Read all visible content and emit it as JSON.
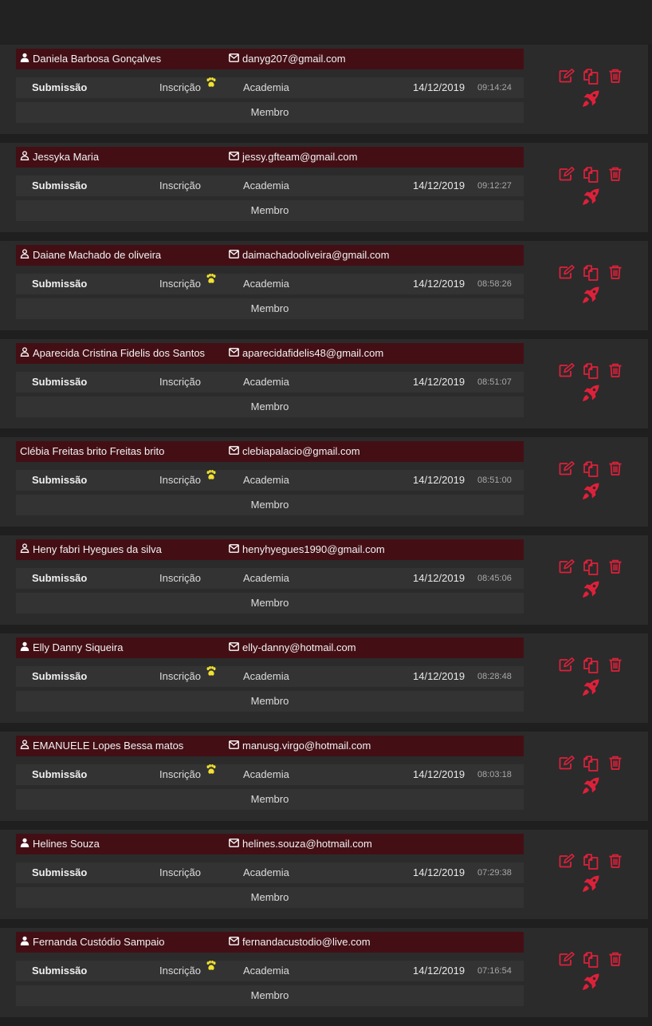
{
  "colors": {
    "accent": "#e0203a",
    "name_bar": "#430f15",
    "row_bg": "#333333",
    "card_bg": "#2b2b2b",
    "paw": "#f2e230"
  },
  "labels": {
    "submission": "Submissão",
    "inscription": "Inscrição",
    "academy": "Academia",
    "role": "Membro"
  },
  "records": [
    {
      "name": "Daniela Barbosa Gonçalves",
      "email": "danyg207@gmail.com",
      "date": "14/12/2019",
      "time": "09:14:24",
      "user_icon": "user-filled-icon",
      "paw": true
    },
    {
      "name": "Jessyka Maria",
      "email": "jessy.gfteam@gmail.com",
      "date": "14/12/2019",
      "time": "09:12:27",
      "user_icon": "user-outline-icon",
      "paw": false
    },
    {
      "name": "Daiane Machado de oliveira",
      "email": "daimachadooliveira@gmail.com",
      "date": "14/12/2019",
      "time": "08:58:26",
      "user_icon": "user-outline-icon",
      "paw": true
    },
    {
      "name": "Aparecida Cristina Fidelis dos Santos",
      "email": "aparecidafidelis48@gmail.com",
      "date": "14/12/2019",
      "time": "08:51:07",
      "user_icon": "user-outline-icon",
      "paw": false
    },
    {
      "name": "Clébia Freitas brito Freitas brito",
      "email": "clebiapalacio@gmail.com",
      "date": "14/12/2019",
      "time": "08:51:00",
      "user_icon": "",
      "paw": true
    },
    {
      "name": "Heny fabri Hyegues da silva",
      "email": "henyhyegues1990@gmail.com",
      "date": "14/12/2019",
      "time": "08:45:06",
      "user_icon": "user-outline-icon",
      "paw": false
    },
    {
      "name": "Elly Danny Siqueira",
      "email": "elly-danny@hotmail.com",
      "date": "14/12/2019",
      "time": "08:28:48",
      "user_icon": "user-filled-icon",
      "paw": true
    },
    {
      "name": "EMANUELE Lopes Bessa matos",
      "email": "manusg.virgo@hotmail.com",
      "date": "14/12/2019",
      "time": "08:03:18",
      "user_icon": "user-outline-icon",
      "paw": true
    },
    {
      "name": "Helines Souza",
      "email": "helines.souza@hotmail.com",
      "date": "14/12/2019",
      "time": "07:29:38",
      "user_icon": "user-filled-icon",
      "paw": false
    },
    {
      "name": "Fernanda Custódio Sampaio",
      "email": "fernandacustodio@live.com",
      "date": "14/12/2019",
      "time": "07:16:54",
      "user_icon": "user-filled-icon",
      "paw": true
    }
  ]
}
